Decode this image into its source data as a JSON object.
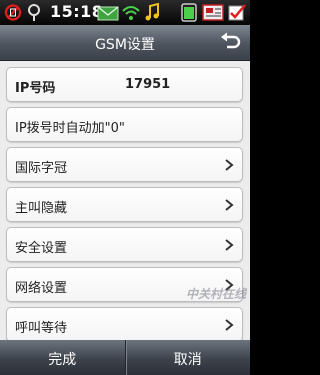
{
  "status_bar": {
    "time": "15:18",
    "icons": [
      "no-sim-icon",
      "location-pin-icon",
      "message-envelope-icon",
      "wifi-icon",
      "music-note-icon",
      "battery-icon",
      "settings-screen-icon",
      "checkbox-icon"
    ]
  },
  "header": {
    "title": "GSM设置",
    "back_icon": "back-arrow-icon"
  },
  "list": {
    "items": [
      {
        "label": "IP号码",
        "value": "17951",
        "chevron": false
      },
      {
        "label": "IP拨号时自动加\"0\"",
        "value": "",
        "chevron": false
      },
      {
        "label": "国际字冠",
        "value": "",
        "chevron": true
      },
      {
        "label": "主叫隐藏",
        "value": "",
        "chevron": true
      },
      {
        "label": "安全设置",
        "value": "",
        "chevron": true
      },
      {
        "label": "网络设置",
        "value": "",
        "chevron": true
      },
      {
        "label": "呼叫等待",
        "value": "",
        "chevron": true
      }
    ]
  },
  "footer": {
    "done_label": "完成",
    "cancel_label": "取消"
  },
  "watermark": "中关村在线",
  "colors": {
    "status_bar": "#111111",
    "title_bar": "#5a616b",
    "list_background": "#ececec",
    "row_background": "#ffffff",
    "bottom_bar": "#3d434b",
    "battery_green": "#4cd04c",
    "alert_red": "#e02020"
  }
}
